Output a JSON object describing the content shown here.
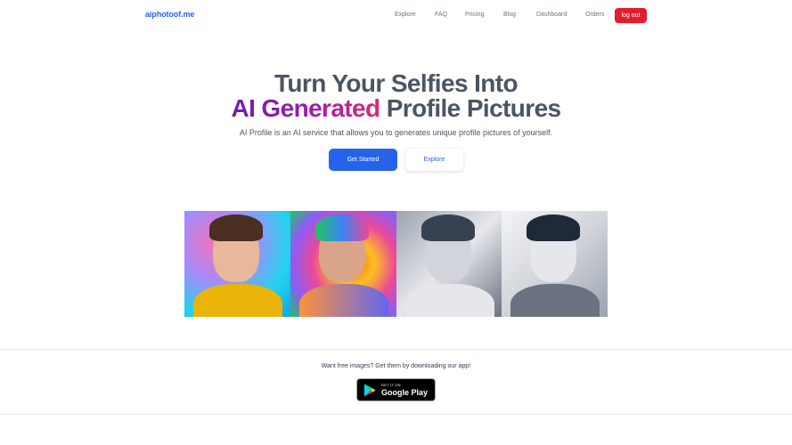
{
  "nav": {
    "logo": "aiphotoof.me",
    "links": [
      "Explore",
      "FAQ",
      "Pricing",
      "Blog",
      "Dashboard",
      "Orders"
    ],
    "logout": "log out",
    "logout_color": "#e11d2e"
  },
  "hero": {
    "line1": "Turn Your Selfies Into",
    "line2_highlight": "AI Generated",
    "line2_rest": "Profile Pictures",
    "subtitle": "AI Profile is an AI service that allows you to generates unique profile pictures of yourself.",
    "primary_button": "Get Started",
    "secondary_button": "Explore",
    "accent_color": "#2563eb"
  },
  "gallery": {
    "images": [
      "portrait-colorful-yellow-shirt",
      "portrait-psychedelic",
      "portrait-grayscale-photo",
      "portrait-pencil-sketch"
    ]
  },
  "app_promo": {
    "text": "Want free images? Get them by downloading our app!",
    "badge_small": "GET IT ON",
    "badge_big": "Google Play"
  }
}
